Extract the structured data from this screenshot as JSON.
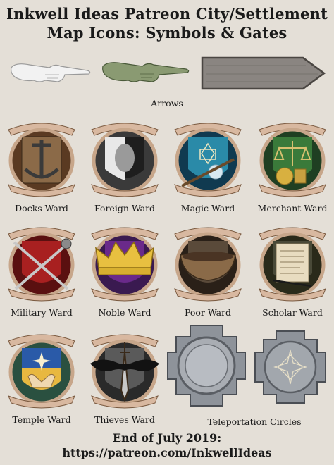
{
  "title": {
    "line1": "Inkwell Ideas Patreon City/Settlement",
    "line2": "Map Icons: Symbols & Gates"
  },
  "arrows_label": "Arrows",
  "icons": [
    {
      "label": "Docks Ward",
      "icon": "anchor-icon",
      "color": "#6b4a2e"
    },
    {
      "label": "Foreign Ward",
      "icon": "face-icon",
      "color": "#2a2a2a"
    },
    {
      "label": "Magic Ward",
      "icon": "wand-icon",
      "color": "#1d5a7a"
    },
    {
      "label": "Merchant Ward",
      "icon": "scales-icon",
      "color": "#2f5a30"
    },
    {
      "label": "Military Ward",
      "icon": "crossed-weapons-icon",
      "color": "#8a1c1c"
    },
    {
      "label": "Noble Ward",
      "icon": "crown-icon",
      "color": "#5a2a7a"
    },
    {
      "label": "Poor Ward",
      "icon": "bowl-icon",
      "color": "#4a3a2a"
    },
    {
      "label": "Scholar Ward",
      "icon": "scroll-icon",
      "color": "#3a3a2a"
    },
    {
      "label": "Temple Ward",
      "icon": "hands-icon",
      "color": "#2a5aa8"
    },
    {
      "label": "Thieves Ward",
      "icon": "dagger-mask-icon",
      "color": "#4a4a4a"
    }
  ],
  "teleport_label": "Teleportation Circles",
  "footer": {
    "line1": "End of July 2019:",
    "line2": "https://patreon.com/InkwellIdeas"
  }
}
